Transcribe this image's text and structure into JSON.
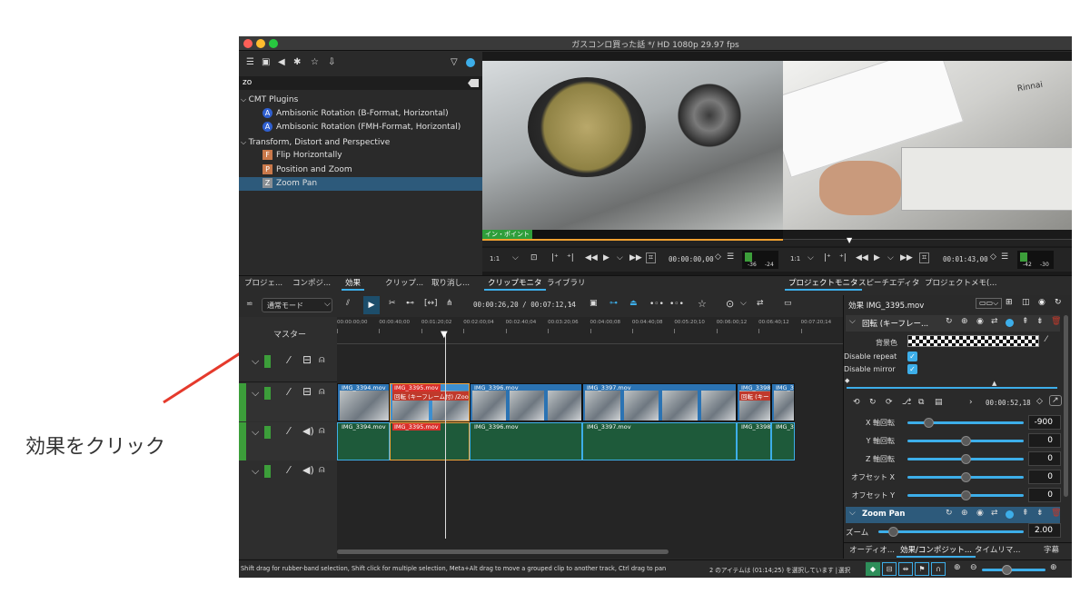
{
  "window": {
    "title": "ガスコンロ買った話 */ HD 1080p 29.97 fps"
  },
  "effects_panel": {
    "search_value": "zo",
    "tree": [
      {
        "label": "CMT Plugins",
        "type": "category"
      },
      {
        "label": "Ambisonic Rotation (B-Format, Horizontal)",
        "badge": "A",
        "type": "item"
      },
      {
        "label": "Ambisonic Rotation (FMH-Format, Horizontal)",
        "badge": "A",
        "type": "item"
      },
      {
        "label": "Transform, Distort and Perspective",
        "type": "category"
      },
      {
        "label": "Flip Horizontally",
        "badge": "F",
        "type": "item"
      },
      {
        "label": "Position and Zoom",
        "badge": "P",
        "type": "item"
      },
      {
        "label": "Zoom Pan",
        "badge": "Z",
        "type": "item",
        "selected": true
      }
    ],
    "tabs": [
      "プロジェ...",
      "コンポジ...",
      "効果",
      "クリップ...",
      "取り消し..."
    ]
  },
  "clip_monitor": {
    "zone_label": "イン・ポイント",
    "zoom": "1:1",
    "timecode": "00:00:00,00",
    "level_labels": [
      "-36",
      "-24"
    ],
    "tabs": [
      "クリップモニタ",
      "ライブラリ"
    ]
  },
  "project_monitor": {
    "zoom": "1:1",
    "timecode": "00:01:43,00",
    "level_labels": [
      "-42",
      "-30"
    ],
    "brand": "Rinnai",
    "tabs": [
      "プロジェクトモニタ",
      "スピーチエディタ",
      "プロジェクトメモ(..."
    ]
  },
  "timeline": {
    "mode": "通常モード",
    "position": "00:00:26,20 / 00:07:12,14",
    "master_label": "マスター",
    "ruler": [
      "00:00:00;00",
      "00:00:40;00",
      "00:01:20;02",
      "00:02:00;04",
      "00:02:40;04",
      "00:03:20;06",
      "00:04:00;08",
      "00:04:40;08",
      "00:05:20;10",
      "00:06:00;12",
      "00:06:40;12",
      "00:07:20;14"
    ],
    "video_clips": [
      {
        "name": "IMG_3394.mov"
      },
      {
        "name": "IMG_3395.mov",
        "effect": "回転 (キーフレーム付) /Zoom"
      },
      {
        "name": "IMG_3396.mov"
      },
      {
        "name": "IMG_3397.mov"
      },
      {
        "name": "IMG_3398.mov",
        "effect": "回転 (キー"
      },
      {
        "name": "IMG_34"
      }
    ],
    "audio_clips": [
      "IMG_3394.mov",
      "IMG_3395.mov",
      "IMG_3396.mov",
      "IMG_3397.mov",
      "IMG_3398.r",
      "IMG_34"
    ]
  },
  "effect_stack": {
    "title": "効果 IMG_3395.mov",
    "rotation": {
      "title": "回転 (キーフレー...",
      "bg_label": "背景色",
      "disable_repeat": "Disable repeat",
      "disable_mirror": "Disable mirror",
      "timecode": "00:00:52,18",
      "params": [
        {
          "label": "X 軸回転",
          "value": "-900",
          "level": 0.18
        },
        {
          "label": "Y 軸回転",
          "value": "0",
          "level": 0.5
        },
        {
          "label": "Z 軸回転",
          "value": "0",
          "level": 0.5
        },
        {
          "label": "オフセット X",
          "value": "0",
          "level": 0.5
        },
        {
          "label": "オフセット Y",
          "value": "0",
          "level": 0.5
        }
      ]
    },
    "zoompan": {
      "title": "Zoom Pan",
      "zoom_label": "ズーム",
      "zoom_value": "2.00",
      "level": 0.1
    },
    "tabs": [
      "オーディオ...",
      "効果/コンポジット...",
      "タイムリマ...",
      "字幕"
    ]
  },
  "statusbar": {
    "hint": "Shift drag for rubber-band selection, Shift click for multiple selection, Meta+Alt drag to move a grouped clip to another track, Ctrl drag to pan",
    "selection": "2 のアイテムは (01:14;25) を選択しています |",
    "select_label": "選択"
  },
  "annotation": {
    "text": "効果をクリック",
    "arrow_color": "#e53a2c"
  },
  "colors": {
    "accent": "#3daee9",
    "selected": "#2d5a7b",
    "clip_video": "#3d8fd0",
    "clip_selected": "#f1a33a",
    "audio": "#1e5a3a"
  }
}
